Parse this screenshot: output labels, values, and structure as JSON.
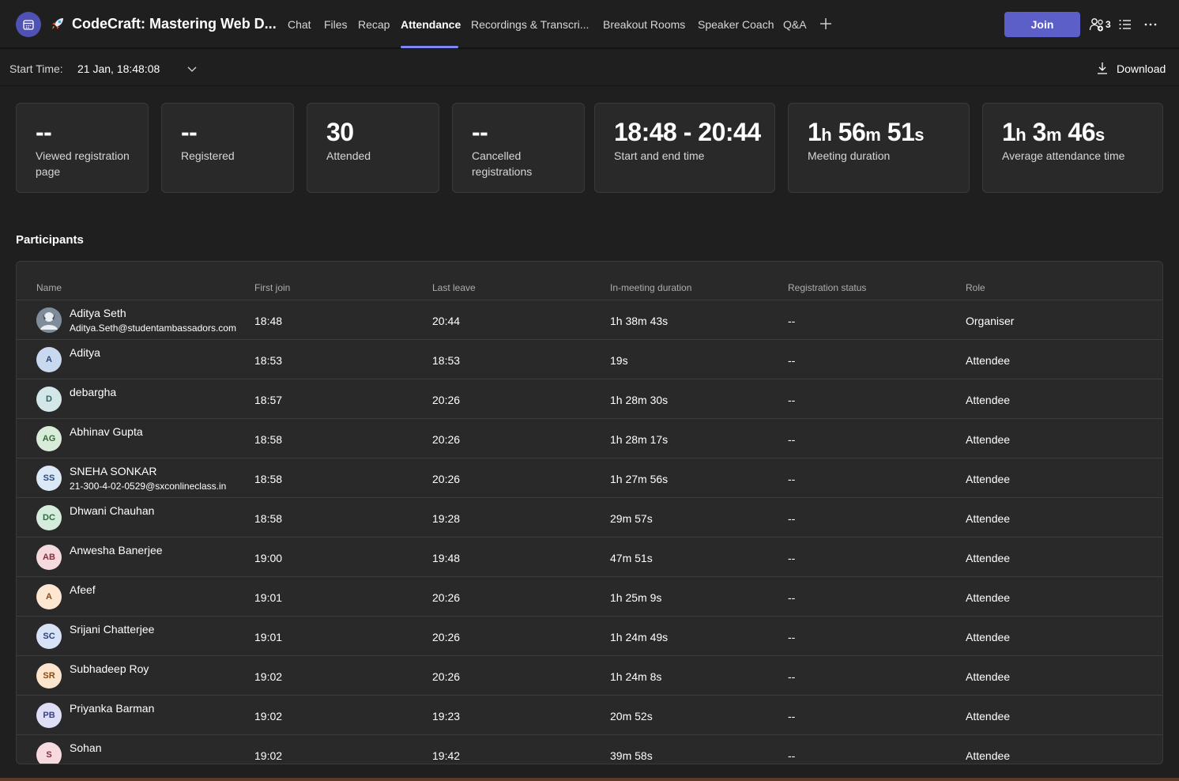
{
  "header": {
    "title": "CodeCraft: Mastering Web D...",
    "tabs": [
      {
        "label": "Chat"
      },
      {
        "label": "Files"
      },
      {
        "label": "Recap"
      },
      {
        "label": "Attendance"
      },
      {
        "label": "Recordings & Transcri..."
      },
      {
        "label": "Breakout Rooms"
      },
      {
        "label": "Speaker Coach"
      },
      {
        "label": "Q&A"
      }
    ],
    "join_label": "Join",
    "participant_count": "3",
    "accent_color": "#5b5fc7"
  },
  "toolbar": {
    "start_label": "Start Time:",
    "start_value": "21 Jan, 18:48:08",
    "download_label": "Download"
  },
  "stats": [
    {
      "value": "--",
      "label": "Viewed registration page"
    },
    {
      "value": "--",
      "label": "Registered"
    },
    {
      "value": "30",
      "label": "Attended"
    },
    {
      "value": "--",
      "label": "Cancelled registrations"
    },
    {
      "value": "18:48 - 20:44",
      "label": "Start and end time"
    },
    {
      "value": {
        "h": "1",
        "hu": "h",
        "m": "56",
        "mu": "m",
        "s": "51",
        "su": "s"
      },
      "label": "Meeting duration"
    },
    {
      "value": {
        "h": "1",
        "hu": "h",
        "m": "3",
        "mu": "m",
        "s": "46",
        "su": "s"
      },
      "label": "Average attendance time"
    }
  ],
  "participants": {
    "title": "Participants",
    "columns": [
      "Name",
      "First join",
      "Last leave",
      "In-meeting duration",
      "Registration status",
      "Role"
    ],
    "rows": [
      {
        "initials": "",
        "name": "Aditya Seth",
        "email": "Aditya.Seth@studentambassadors.com",
        "first_join": "18:48",
        "last_leave": "20:44",
        "duration": "1h 38m 43s",
        "status": "--",
        "role": "Organiser"
      },
      {
        "initials": "A",
        "name": "Aditya",
        "email": "",
        "first_join": "18:53",
        "last_leave": "18:53",
        "duration": "19s",
        "status": "--",
        "role": "Attendee"
      },
      {
        "initials": "D",
        "name": "debargha",
        "email": "",
        "first_join": "18:57",
        "last_leave": "20:26",
        "duration": "1h 28m 30s",
        "status": "--",
        "role": "Attendee"
      },
      {
        "initials": "AG",
        "name": "Abhinav Gupta",
        "email": "",
        "first_join": "18:58",
        "last_leave": "20:26",
        "duration": "1h 28m 17s",
        "status": "--",
        "role": "Attendee"
      },
      {
        "initials": "SS",
        "name": "SNEHA SONKAR",
        "email": "21-300-4-02-0529@sxconlineclass.in",
        "first_join": "18:58",
        "last_leave": "20:26",
        "duration": "1h 27m 56s",
        "status": "--",
        "role": "Attendee"
      },
      {
        "initials": "DC",
        "name": "Dhwani Chauhan",
        "email": "",
        "first_join": "18:58",
        "last_leave": "19:28",
        "duration": "29m 57s",
        "status": "--",
        "role": "Attendee"
      },
      {
        "initials": "AB",
        "name": "Anwesha Banerjee",
        "email": "",
        "first_join": "19:00",
        "last_leave": "19:48",
        "duration": "47m 51s",
        "status": "--",
        "role": "Attendee"
      },
      {
        "initials": "A",
        "name": "Afeef",
        "email": "",
        "first_join": "19:01",
        "last_leave": "20:26",
        "duration": "1h 25m 9s",
        "status": "--",
        "role": "Attendee"
      },
      {
        "initials": "SC",
        "name": "Srijani Chatterjee",
        "email": "",
        "first_join": "19:01",
        "last_leave": "20:26",
        "duration": "1h 24m 49s",
        "status": "--",
        "role": "Attendee"
      },
      {
        "initials": "SR",
        "name": "Subhadeep Roy",
        "email": "",
        "first_join": "19:02",
        "last_leave": "20:26",
        "duration": "1h 24m 8s",
        "status": "--",
        "role": "Attendee"
      },
      {
        "initials": "PB",
        "name": "Priyanka Barman",
        "email": "",
        "first_join": "19:02",
        "last_leave": "19:23",
        "duration": "20m 52s",
        "status": "--",
        "role": "Attendee"
      },
      {
        "initials": "S",
        "name": "Sohan",
        "email": "",
        "first_join": "19:02",
        "last_leave": "19:42",
        "duration": "39m 58s",
        "status": "--",
        "role": "Attendee"
      }
    ]
  }
}
